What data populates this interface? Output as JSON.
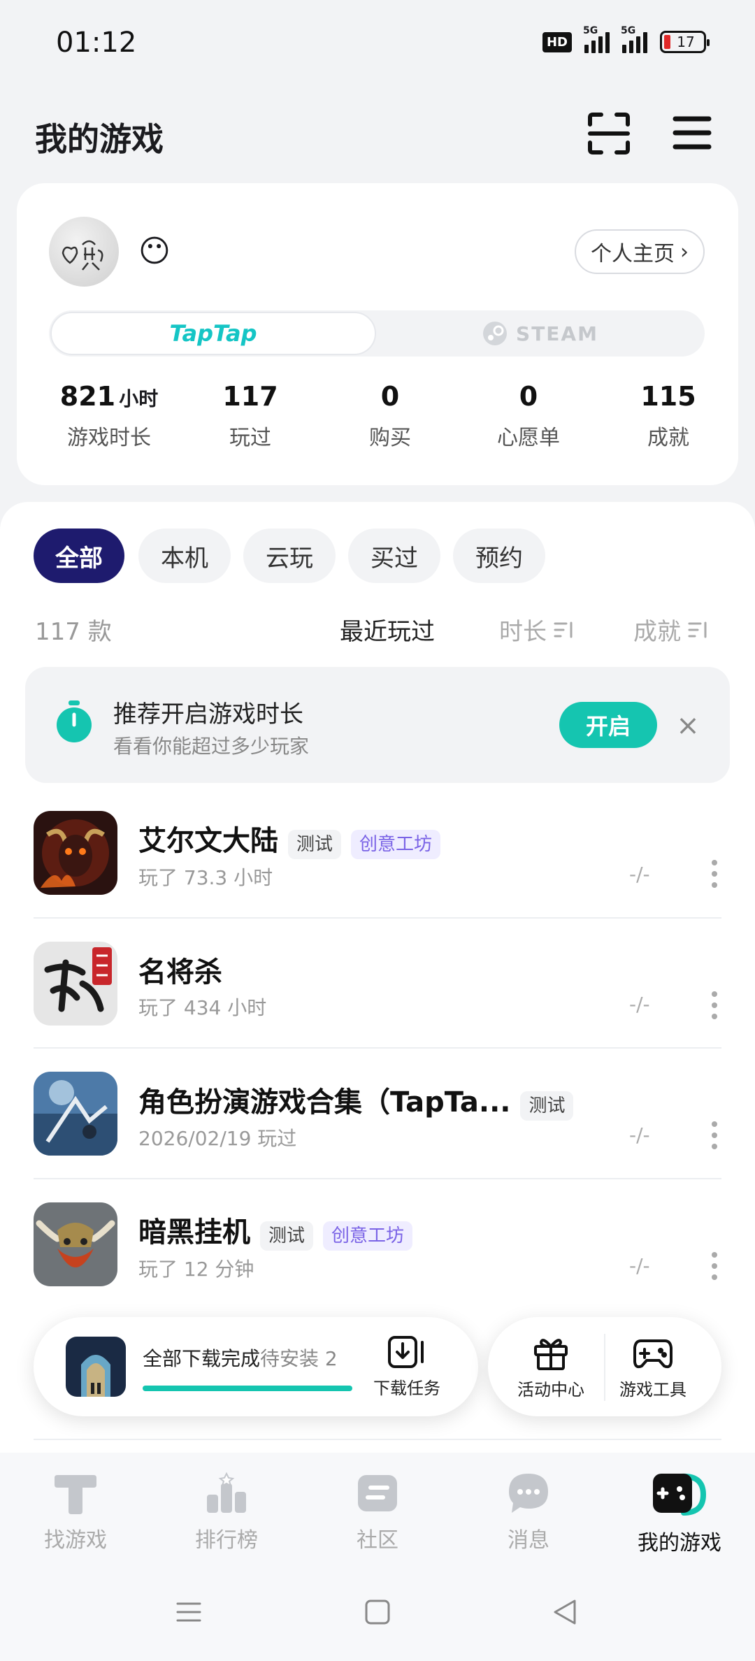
{
  "status_bar": {
    "time": "01:12",
    "hd": "HD",
    "sim1": "5G",
    "sim2": "5G",
    "battery": "17"
  },
  "header": {
    "title": "我的游戏"
  },
  "profile": {
    "emoji": "😶",
    "homepage_label": "个人主页",
    "platforms": {
      "taptap": "TapTap",
      "steam": "STEAM"
    },
    "stats": [
      {
        "value": "821",
        "unit": "小时",
        "label": "游戏时长"
      },
      {
        "value": "117",
        "unit": "",
        "label": "玩过"
      },
      {
        "value": "0",
        "unit": "",
        "label": "购买"
      },
      {
        "value": "0",
        "unit": "",
        "label": "心愿单"
      },
      {
        "value": "115",
        "unit": "",
        "label": "成就"
      }
    ]
  },
  "filters": {
    "chips": [
      "全部",
      "本机",
      "云玩",
      "买过",
      "预约"
    ]
  },
  "list_meta": {
    "count": "117 款",
    "sort_recent": "最近玩过",
    "sort_duration": "时长",
    "sort_achievement": "成就"
  },
  "banner": {
    "title": "推荐开启游戏时长",
    "subtitle": "看看你能超过多少玩家",
    "button": "开启"
  },
  "games": [
    {
      "title": "艾尔文大陆",
      "tags": [
        "测试",
        "创意工坊"
      ],
      "sub": "玩了 73.3 小时",
      "stat": "-/-"
    },
    {
      "title": "名将杀",
      "tags": [],
      "sub": "玩了 434 小时",
      "stat": "-/-"
    },
    {
      "title": "角色扮演游戏合集（TapTa...",
      "tags": [
        "测试"
      ],
      "sub": "2026/02/19 玩过",
      "stat": "-/-"
    },
    {
      "title": "暗黑挂机",
      "tags": [
        "测试",
        "创意工坊"
      ],
      "sub": "玩了 12 分钟",
      "stat": "-/-"
    }
  ],
  "download_bar": {
    "status": "全部下载完成",
    "pending": "待安装 2",
    "tasks_label": "下载任务",
    "progress": 1.0
  },
  "quick_actions": {
    "activity": "活动中心",
    "tools": "游戏工具"
  },
  "bottom_nav": [
    "找游戏",
    "排行榜",
    "社区",
    "消息",
    "我的游戏"
  ]
}
